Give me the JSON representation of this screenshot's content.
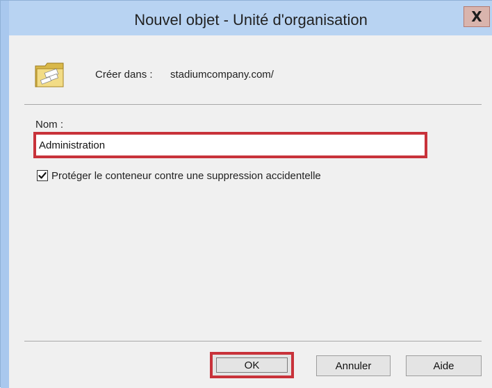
{
  "window": {
    "title": "Nouvel objet - Unité d'organisation",
    "close_glyph": "X"
  },
  "header": {
    "icon": "organizational-unit-folder-icon",
    "create_in_label": "Créer dans :",
    "create_in_path": "stadiumcompany.com/"
  },
  "form": {
    "name_label": "Nom :",
    "name_value": "Administration",
    "protect_checked": true,
    "protect_label": "Protéger le conteneur contre une suppression accidentelle"
  },
  "buttons": {
    "ok": "OK",
    "cancel": "Annuler",
    "help": "Aide"
  },
  "colors": {
    "titlebar": "#b8d3f2",
    "highlight": "#c8323a",
    "dialog_bg": "#f0f0f0"
  }
}
